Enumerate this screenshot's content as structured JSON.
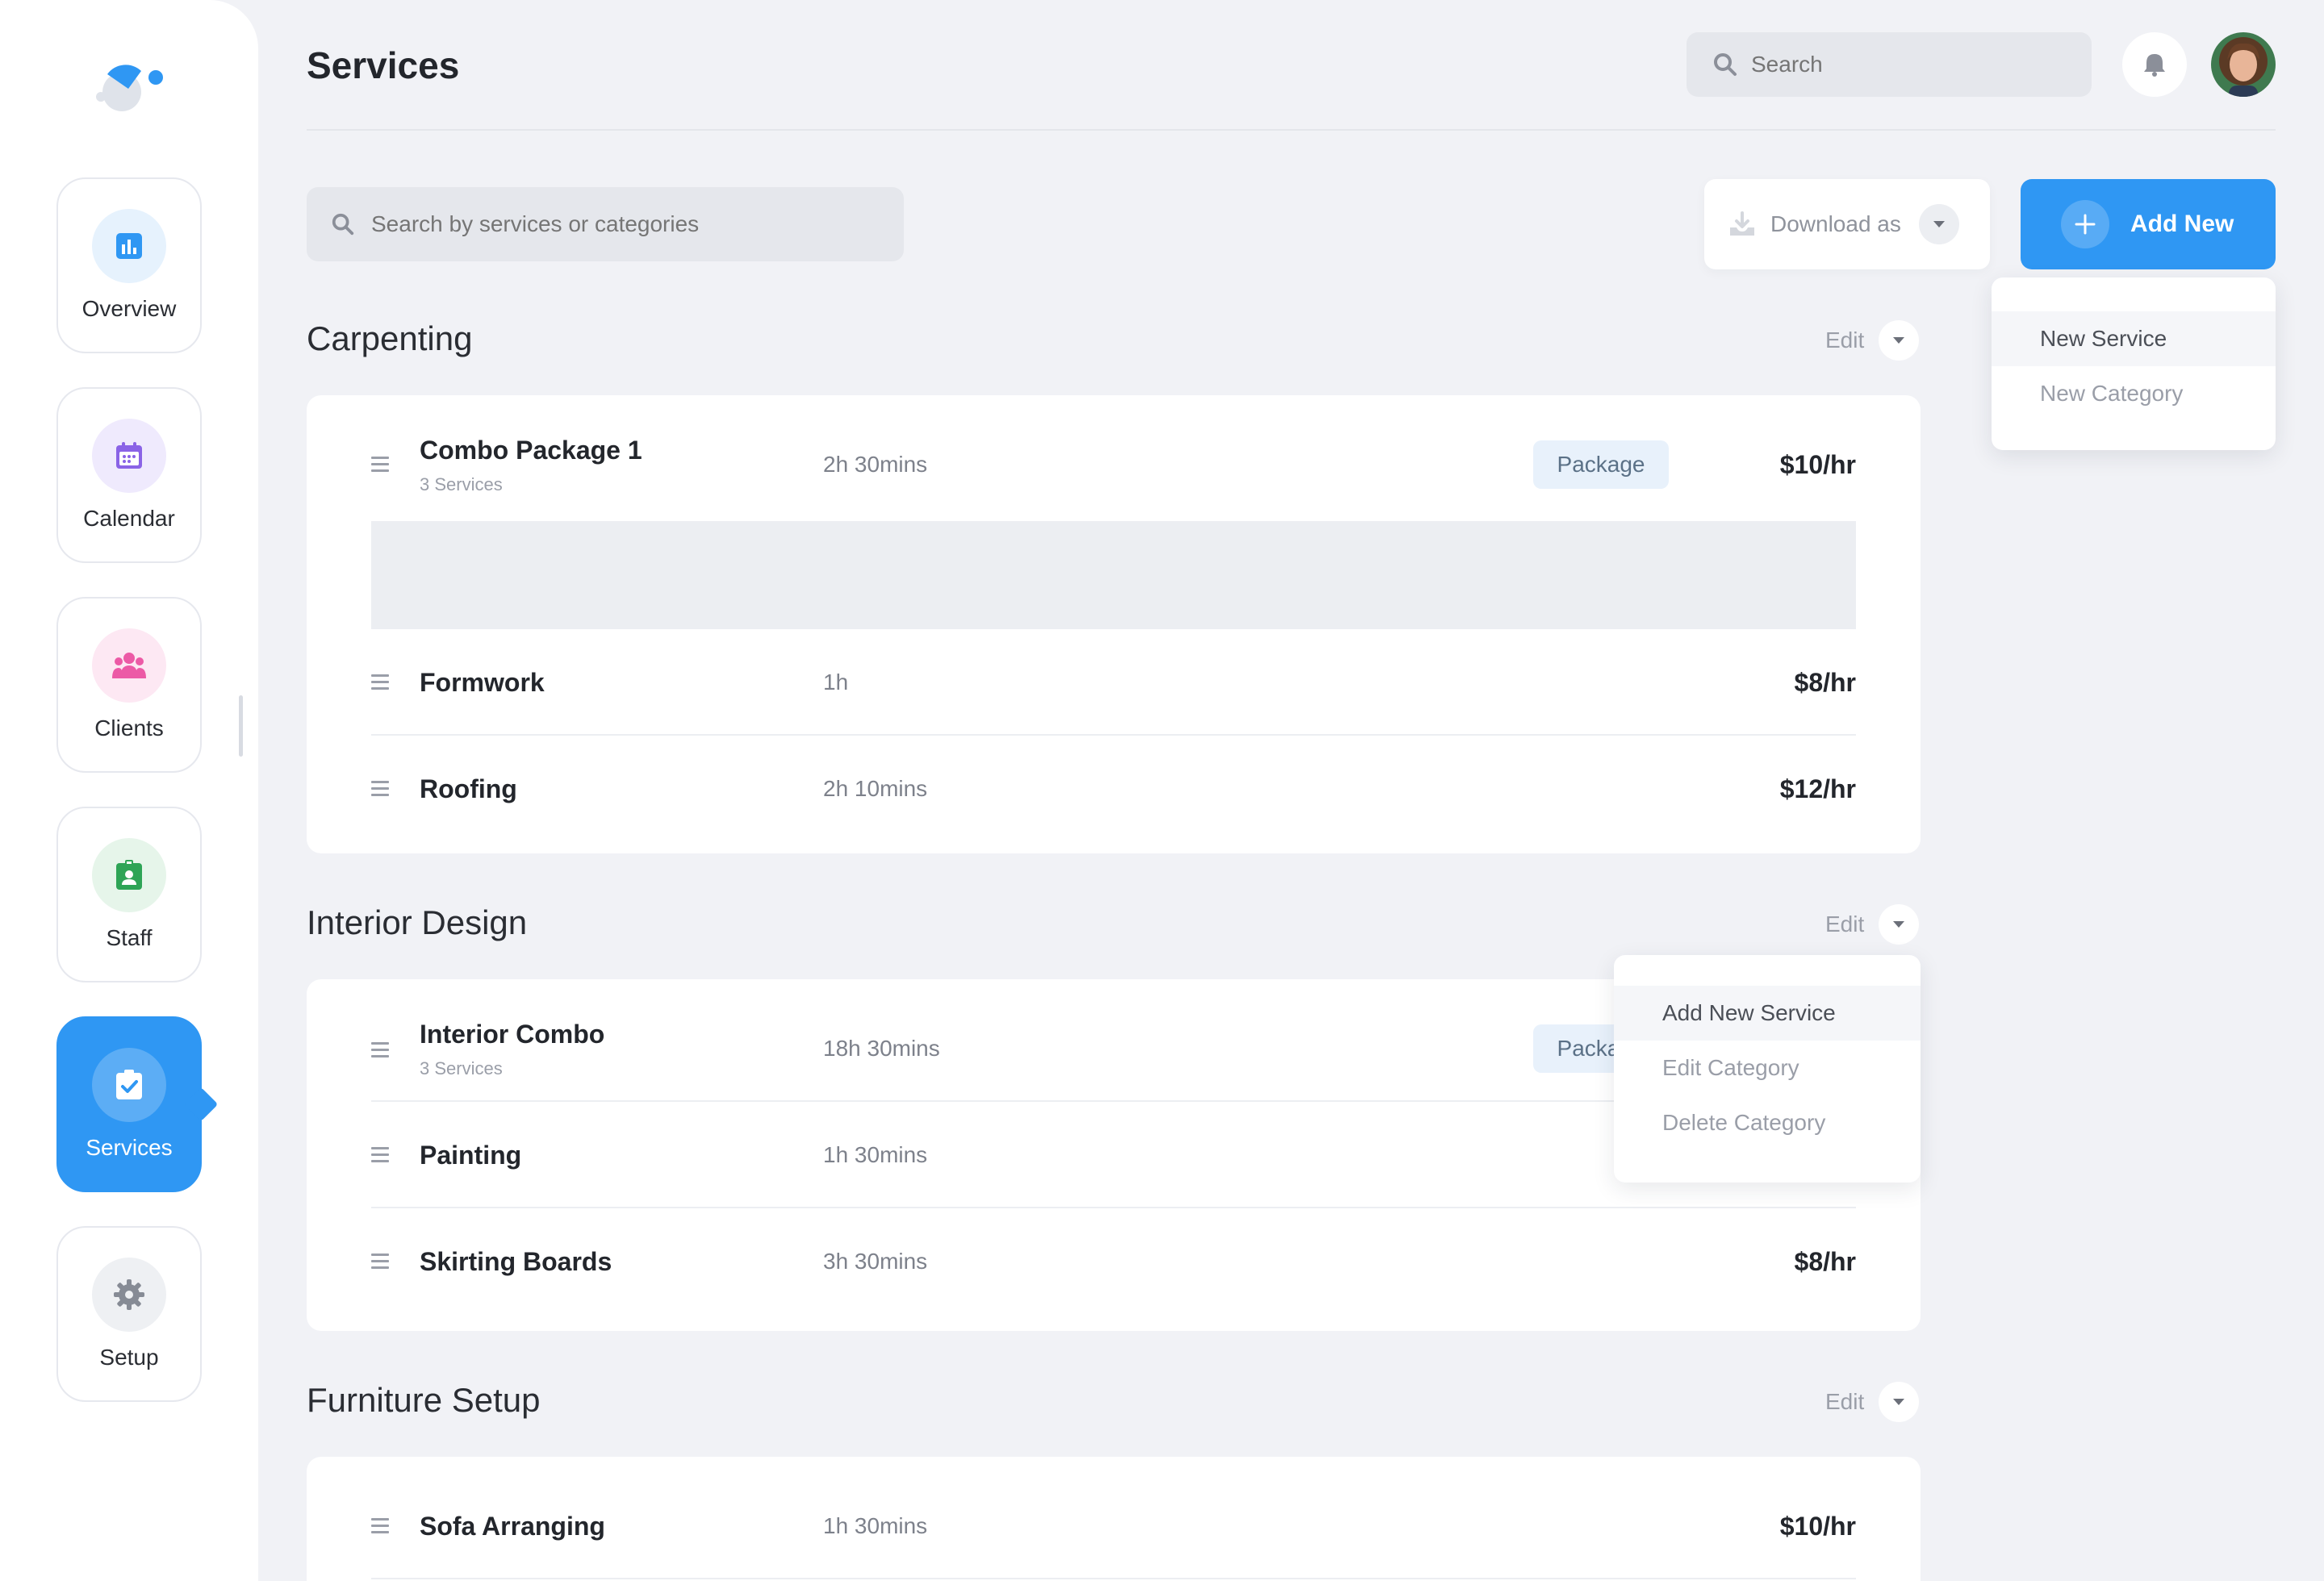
{
  "header": {
    "title": "Services",
    "search_placeholder": "Search"
  },
  "sidebar": {
    "items": [
      {
        "label": "Overview",
        "icon": "chart-icon",
        "active": false
      },
      {
        "label": "Calendar",
        "icon": "calendar-icon",
        "active": false
      },
      {
        "label": "Clients",
        "icon": "users-icon",
        "active": false
      },
      {
        "label": "Staff",
        "icon": "badge-icon",
        "active": false
      },
      {
        "label": "Services",
        "icon": "clipboard-check-icon",
        "active": true
      },
      {
        "label": "Setup",
        "icon": "gear-icon",
        "active": false
      }
    ]
  },
  "toolbar": {
    "search_placeholder": "Search by services or categories",
    "download_label": "Download as",
    "add_label": "Add New"
  },
  "add_menu": {
    "options": [
      "New Service",
      "New Category"
    ]
  },
  "category_menu": {
    "options": [
      "Add New Service",
      "Edit Category",
      "Delete Category"
    ]
  },
  "edit_label": "Edit",
  "categories": [
    {
      "title": "Carpenting",
      "rows": [
        {
          "name": "Combo Package 1",
          "sub": "3 Services",
          "duration": "2h 30mins",
          "badge": "Package",
          "price": "$10/hr"
        },
        {
          "name": "Formwork",
          "duration": "1h",
          "price": "$8/hr"
        },
        {
          "name": "Roofing",
          "duration": "2h 10mins",
          "price": "$12/hr"
        }
      ]
    },
    {
      "title": "Interior Design",
      "rows": [
        {
          "name": "Interior Combo",
          "sub": "3 Services",
          "duration": "18h 30mins",
          "badge": "Package"
        },
        {
          "name": "Painting",
          "duration": "1h 30mins"
        },
        {
          "name": "Skirting Boards",
          "duration": "3h 30mins",
          "price": "$8/hr"
        }
      ]
    },
    {
      "title": "Furniture Setup",
      "rows": [
        {
          "name": "Sofa Arranging",
          "duration": "1h 30mins",
          "price": "$10/hr"
        }
      ]
    }
  ],
  "colors": {
    "accent": "#2f97f3",
    "background": "#f1f2f6",
    "badge_bg": "#e8f1fb"
  }
}
